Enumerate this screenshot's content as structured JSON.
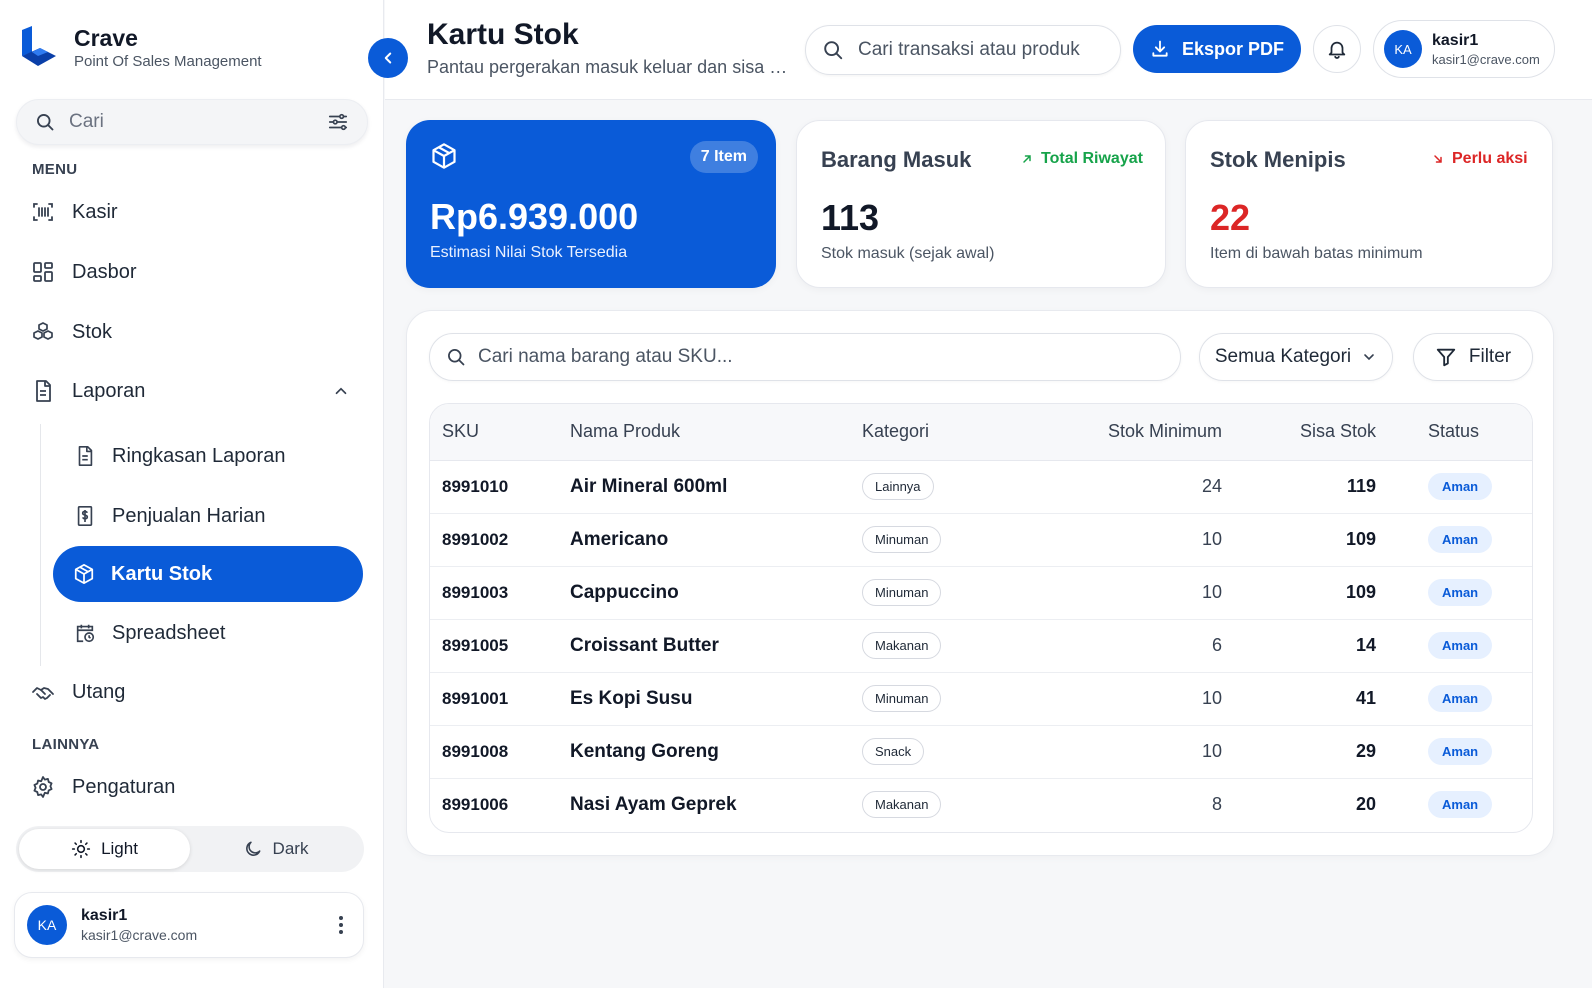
{
  "brand": {
    "name": "Crave",
    "subtitle": "Point Of Sales Management"
  },
  "sidebar": {
    "search_placeholder": "Cari",
    "menu_label": "MENU",
    "items": [
      {
        "label": "Kasir",
        "icon": "barcode-scan-icon"
      },
      {
        "label": "Dasbor",
        "icon": "dashboard-grid-icon"
      },
      {
        "label": "Stok",
        "icon": "boxes-icon"
      },
      {
        "label": "Laporan",
        "icon": "document-icon",
        "expanded": true
      }
    ],
    "laporan_children": [
      {
        "label": "Ringkasan Laporan",
        "icon": "document-icon"
      },
      {
        "label": "Penjualan Harian",
        "icon": "receipt-dollar-icon"
      },
      {
        "label": "Kartu Stok",
        "icon": "package-icon",
        "active": true
      },
      {
        "label": "Spreadsheet",
        "icon": "calendar-clock-icon"
      }
    ],
    "utang_label": "Utang",
    "other_label": "LAINNYA",
    "settings_label": "Pengaturan",
    "theme": {
      "light": "Light",
      "dark": "Dark",
      "selected": "light"
    },
    "user": {
      "initials": "KA",
      "name": "kasir1",
      "email": "kasir1@crave.com"
    }
  },
  "header": {
    "title": "Kartu Stok",
    "subtitle": "Pantau pergerakan masuk keluar dan sisa barang",
    "search_placeholder": "Cari transaksi atau produk",
    "export_label": "Ekspor PDF",
    "user": {
      "initials": "KA",
      "name": "kasir1",
      "email": "kasir1@crave.com"
    }
  },
  "cards": {
    "stock_value": {
      "badge": "7 Item",
      "value": "Rp6.939.000",
      "label": "Estimasi Nilai Stok Tersedia"
    },
    "incoming": {
      "title": "Barang Masuk",
      "trend": "Total Riwayat",
      "value": "113",
      "label": "Stok masuk (sejak awal)"
    },
    "low_stock": {
      "title": "Stok Menipis",
      "trend": "Perlu aksi",
      "value": "22",
      "label": "Item di bawah batas minimum"
    }
  },
  "table_controls": {
    "search_placeholder": "Cari nama barang atau SKU...",
    "category_selected": "Semua Kategori",
    "filter_label": "Filter"
  },
  "table": {
    "columns": [
      "SKU",
      "Nama Produk",
      "Kategori",
      "Stok Minimum",
      "Sisa Stok",
      "Status"
    ],
    "rows": [
      {
        "sku": "8991010",
        "name": "Air Mineral 600ml",
        "category": "Lainnya",
        "min": "24",
        "remaining": "119",
        "status": "Aman"
      },
      {
        "sku": "8991002",
        "name": "Americano",
        "category": "Minuman",
        "min": "10",
        "remaining": "109",
        "status": "Aman"
      },
      {
        "sku": "8991003",
        "name": "Cappuccino",
        "category": "Minuman",
        "min": "10",
        "remaining": "109",
        "status": "Aman"
      },
      {
        "sku": "8991005",
        "name": "Croissant Butter",
        "category": "Makanan",
        "min": "6",
        "remaining": "14",
        "status": "Aman"
      },
      {
        "sku": "8991001",
        "name": "Es Kopi Susu",
        "category": "Minuman",
        "min": "10",
        "remaining": "41",
        "status": "Aman"
      },
      {
        "sku": "8991008",
        "name": "Kentang Goreng",
        "category": "Snack",
        "min": "10",
        "remaining": "29",
        "status": "Aman"
      },
      {
        "sku": "8991006",
        "name": "Nasi Ayam Geprek",
        "category": "Makanan",
        "min": "8",
        "remaining": "20",
        "status": "Aman"
      }
    ]
  },
  "colors": {
    "primary": "#0a5bd8",
    "success": "#16a34a",
    "danger": "#dc2626"
  }
}
